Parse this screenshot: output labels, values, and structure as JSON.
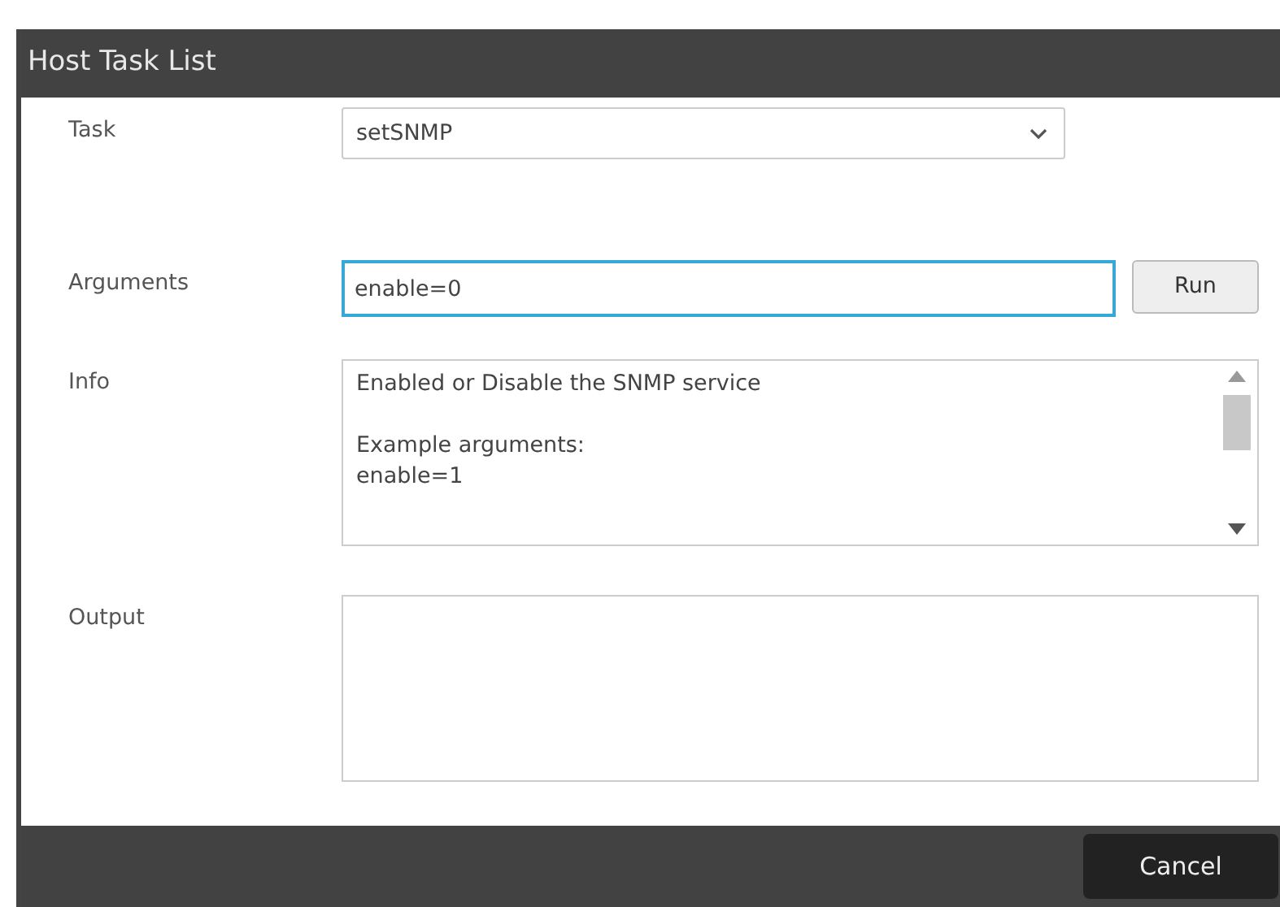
{
  "window": {
    "title": "Host Task List"
  },
  "fields": [
    {
      "kind": "select",
      "label": "Task",
      "value": "setSNMP"
    },
    {
      "kind": "input",
      "label": "Arguments",
      "value": "enable=0",
      "focused": true,
      "button": "Run"
    },
    {
      "kind": "info",
      "label": "Info",
      "paragraphs": [
        [
          "Enabled or Disable the SNMP service"
        ],
        [
          "Example arguments:",
          "enable=1"
        ]
      ]
    },
    {
      "kind": "output",
      "label": "Output"
    }
  ],
  "buttons": [
    "Cancel"
  ]
}
